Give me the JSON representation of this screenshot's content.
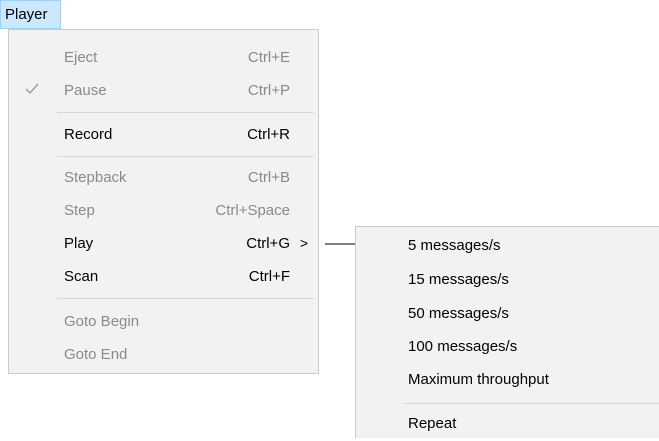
{
  "menubar": {
    "title": "Player"
  },
  "menu": {
    "items": [
      {
        "label": "Eject",
        "shortcut": "Ctrl+E",
        "enabled": false
      },
      {
        "label": "Pause",
        "shortcut": "Ctrl+P",
        "enabled": false,
        "checked": true
      },
      {
        "label": "Record",
        "shortcut": "Ctrl+R",
        "enabled": true
      },
      {
        "label": "Stepback",
        "shortcut": "Ctrl+B",
        "enabled": false
      },
      {
        "label": "Step",
        "shortcut": "Ctrl+Space",
        "enabled": false
      },
      {
        "label": "Play",
        "shortcut": "Ctrl+G",
        "enabled": true,
        "has_submenu": true,
        "submenu_arrow": ">"
      },
      {
        "label": "Scan",
        "shortcut": "Ctrl+F",
        "enabled": true
      },
      {
        "label": "Goto Begin",
        "shortcut": "",
        "enabled": false
      },
      {
        "label": "Goto End",
        "shortcut": "",
        "enabled": false
      }
    ]
  },
  "submenu": {
    "items": [
      {
        "label": "5 messages/s"
      },
      {
        "label": "15 messages/s"
      },
      {
        "label": "50 messages/s"
      },
      {
        "label": "100 messages/s"
      },
      {
        "label": "Maximum throughput"
      },
      {
        "label": "Repeat"
      }
    ]
  },
  "colors": {
    "menu_bg": "#f2f2f2",
    "menubar_highlight": "#cce8ff",
    "disabled_text": "#8a8a8a",
    "separator": "#d7d7d7"
  }
}
